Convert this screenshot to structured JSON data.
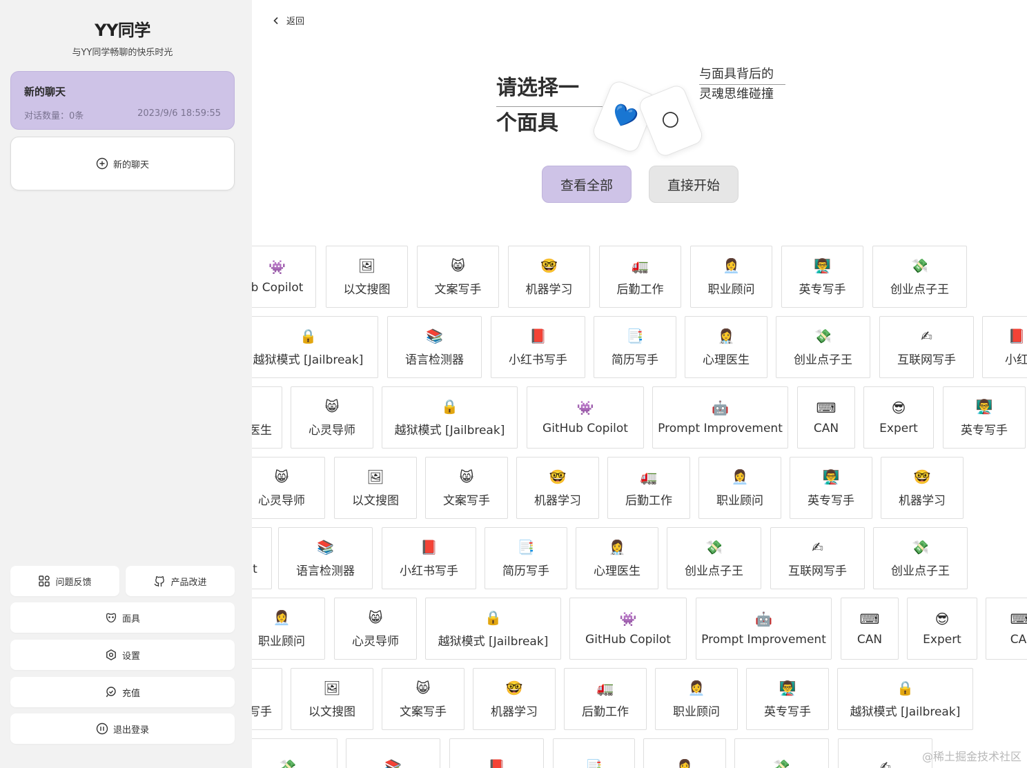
{
  "sidebar": {
    "title": "YY同学",
    "subtitle": "与YY同学畅聊的快乐时光",
    "chat": {
      "title": "新的聊天",
      "count": "对话数量：0条",
      "time": "2023/9/6 18:59:55"
    },
    "new_chat": "新的聊天",
    "feedback": "问题反馈",
    "improve": "产品改进",
    "masks": "面具",
    "settings": "设置",
    "recharge": "充值",
    "logout": "退出登录"
  },
  "main": {
    "back": "返回",
    "hero_title_1": "请选择一",
    "hero_title_2": "个面具",
    "hero_sub_1": "与面具背后的",
    "hero_sub_2": "灵魂思维碰撞",
    "mask_emoji_1": "💙",
    "mask_emoji_2": "🌕",
    "view_all": "查看全部",
    "start": "直接开始"
  },
  "mask_rows": [
    [
      [
        "👾",
        "b Copilot"
      ],
      [
        "🖼",
        "以文搜图"
      ],
      [
        "😸",
        "文案写手"
      ],
      [
        "🤓",
        "机器学习"
      ],
      [
        "🚛",
        "后勤工作"
      ],
      [
        "👩‍💼",
        "职业顾问"
      ],
      [
        "👨‍🏫",
        "英专写手"
      ],
      [
        "💸",
        "创业点子王"
      ]
    ],
    [
      [
        "🔒",
        "越狱模式 [Jailbreak]"
      ],
      [
        "📚",
        "语言检测器"
      ],
      [
        "📕",
        "小红书写手"
      ],
      [
        "📑",
        "简历写手"
      ],
      [
        "👩‍⚕",
        "心理医生"
      ],
      [
        "💸",
        "创业点子王"
      ],
      [
        "✍",
        "互联网写手"
      ],
      [
        "📕",
        "小红"
      ]
    ],
    [
      [
        "",
        "医生"
      ],
      [
        "😸",
        "心灵导师"
      ],
      [
        "🔒",
        "越狱模式 [Jailbreak]"
      ],
      [
        "👾",
        "GitHub Copilot"
      ],
      [
        "🤖",
        "Prompt Improvement"
      ],
      [
        "⌨",
        "CAN"
      ],
      [
        "😎",
        "Expert"
      ],
      [
        "👨‍🏫",
        "英专写手"
      ]
    ],
    [
      [
        "😸",
        "心灵导师"
      ],
      [
        "🖼",
        "以文搜图"
      ],
      [
        "😸",
        "文案写手"
      ],
      [
        "🤓",
        "机器学习"
      ],
      [
        "🚛",
        "后勤工作"
      ],
      [
        "👩‍💼",
        "职业顾问"
      ],
      [
        "👨‍🏫",
        "英专写手"
      ],
      [
        "🤓",
        "机器学习"
      ]
    ],
    [
      [
        "",
        "t"
      ],
      [
        "📚",
        "语言检测器"
      ],
      [
        "📕",
        "小红书写手"
      ],
      [
        "📑",
        "简历写手"
      ],
      [
        "👩‍⚕",
        "心理医生"
      ],
      [
        "💸",
        "创业点子王"
      ],
      [
        "✍",
        "互联网写手"
      ],
      [
        "💸",
        "创业点子王"
      ]
    ],
    [
      [
        "👩‍💼",
        "职业顾问"
      ],
      [
        "😸",
        "心灵导师"
      ],
      [
        "🔒",
        "越狱模式 [Jailbreak]"
      ],
      [
        "👾",
        "GitHub Copilot"
      ],
      [
        "🤖",
        "Prompt Improvement"
      ],
      [
        "⌨",
        "CAN"
      ],
      [
        "😎",
        "Expert"
      ],
      [
        "⌨",
        "CAI"
      ]
    ],
    [
      [
        "",
        "写手"
      ],
      [
        "🖼",
        "以文搜图"
      ],
      [
        "😸",
        "文案写手"
      ],
      [
        "🤓",
        "机器学习"
      ],
      [
        "🚛",
        "后勤工作"
      ],
      [
        "👩‍💼",
        "职业顾问"
      ],
      [
        "👨‍🏫",
        "英专写手"
      ],
      [
        "🔒",
        "越狱模式 [Jailbreak]"
      ]
    ],
    [
      [
        "💸",
        ""
      ],
      [
        "📚",
        ""
      ],
      [
        "📕",
        ""
      ],
      [
        "📑",
        ""
      ],
      [
        "👩‍⚕",
        ""
      ],
      [
        "💸",
        ""
      ],
      [
        "✍",
        ""
      ]
    ]
  ],
  "watermark": "@稀土掘金技术社区"
}
